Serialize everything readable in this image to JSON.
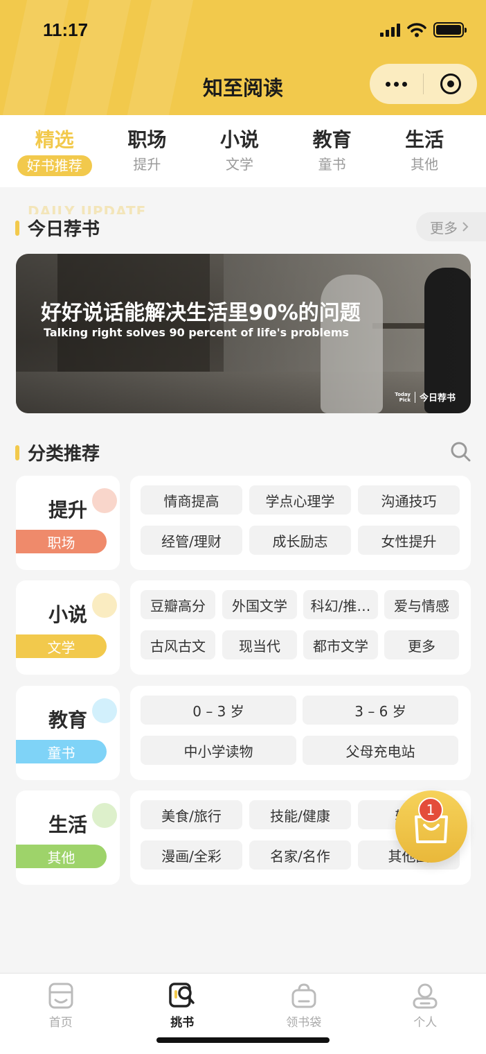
{
  "status_bar": {
    "time": "11:17"
  },
  "header": {
    "title": "知至阅读"
  },
  "tabs": [
    {
      "title": "精选",
      "sub": "好书推荐",
      "active": true
    },
    {
      "title": "职场",
      "sub": "提升"
    },
    {
      "title": "小说",
      "sub": "文学"
    },
    {
      "title": "教育",
      "sub": "童书"
    },
    {
      "title": "生活",
      "sub": "其他"
    }
  ],
  "daily": {
    "ghost_text": "DAILY UPDATE",
    "section_title": "今日荐书",
    "more_label": "更多",
    "banner": {
      "title": "好好说话能解决生活里90%的问题",
      "subtitle": "Talking right solves 90 percent of life's problems",
      "tag_small_1": "Today",
      "tag_small_2": "Pick",
      "tag": "今日荐书"
    }
  },
  "categories": {
    "section_title": "分类推荐",
    "groups": [
      {
        "name": "提升",
        "pill": "职场",
        "color": "#ef8a6b",
        "chips": [
          "情商提高",
          "学点心理学",
          "沟通技巧",
          "经管/理财",
          "成长励志",
          "女性提升"
        ]
      },
      {
        "name": "小说",
        "pill": "文学",
        "color": "#f2c94c",
        "chips": [
          "豆瓣高分",
          "外国文学",
          "科幻/推…",
          "爱与情感",
          "古风古文",
          "现当代",
          "都市文学",
          "更多"
        ]
      },
      {
        "name": "教育",
        "pill": "童书",
        "color": "#7fd3f7",
        "chips": [
          "0 – 3 岁",
          "3 – 6 岁",
          "中小学读物",
          "父母充电站"
        ]
      },
      {
        "name": "生活",
        "pill": "其他",
        "color": "#9ed36a",
        "chips": [
          "美食/旅行",
          "技能/健康",
          "轻松",
          "漫画/全彩",
          "名家/名作",
          "其他图"
        ]
      }
    ]
  },
  "cart": {
    "count": "1"
  },
  "bottom_nav": [
    {
      "label": "首页",
      "icon": "home-icon"
    },
    {
      "label": "挑书",
      "icon": "pick-book-icon",
      "active": true
    },
    {
      "label": "领书袋",
      "icon": "book-bag-icon"
    },
    {
      "label": "个人",
      "icon": "profile-icon"
    }
  ],
  "colors": {
    "accent": "#f2c94c",
    "background": "#f5f5f5"
  }
}
